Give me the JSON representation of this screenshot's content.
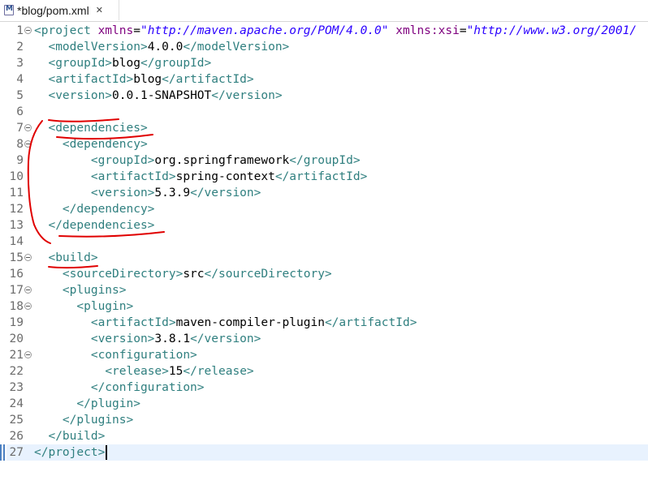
{
  "tab": {
    "title": "*blog/pom.xml",
    "close_glyph": "✕",
    "icon": "maven-pom-file-icon"
  },
  "editor": {
    "current_line": 27,
    "lines": [
      {
        "n": "1",
        "fold": true,
        "html": "<span class=\"t\">&lt;project</span> <span class=\"a\">xmlns</span>=<span class=\"s\">\"http://maven.apache.org/POM/4.0.0\"</span> <span class=\"a\">xmlns:xsi</span>=<span class=\"s\">\"http://www.w3.org/2001/</span>"
      },
      {
        "n": "2",
        "fold": false,
        "html": "  <span class=\"t\">&lt;modelVersion&gt;</span><span class=\"x\">4.0.0</span><span class=\"t\">&lt;/modelVersion&gt;</span>"
      },
      {
        "n": "3",
        "fold": false,
        "html": "  <span class=\"t\">&lt;groupId&gt;</span><span class=\"x\">blog</span><span class=\"t\">&lt;/groupId&gt;</span>"
      },
      {
        "n": "4",
        "fold": false,
        "html": "  <span class=\"t\">&lt;artifactId&gt;</span><span class=\"x\">blog</span><span class=\"t\">&lt;/artifactId&gt;</span>"
      },
      {
        "n": "5",
        "fold": false,
        "html": "  <span class=\"t\">&lt;version&gt;</span><span class=\"x\">0.0.1-SNAPSHOT</span><span class=\"t\">&lt;/version&gt;</span>"
      },
      {
        "n": "6",
        "fold": false,
        "html": ""
      },
      {
        "n": "7",
        "fold": true,
        "html": "  <span class=\"t\">&lt;dependencies&gt;</span>"
      },
      {
        "n": "8",
        "fold": true,
        "html": "    <span class=\"t\">&lt;dependency&gt;</span>"
      },
      {
        "n": "9",
        "fold": false,
        "html": "        <span class=\"t\">&lt;groupId&gt;</span><span class=\"x\">org.springframework</span><span class=\"t\">&lt;/groupId&gt;</span>"
      },
      {
        "n": "10",
        "fold": false,
        "html": "        <span class=\"t\">&lt;artifactId&gt;</span><span class=\"x\">spring-context</span><span class=\"t\">&lt;/artifactId&gt;</span>"
      },
      {
        "n": "11",
        "fold": false,
        "html": "        <span class=\"t\">&lt;version&gt;</span><span class=\"x\">5.3.9</span><span class=\"t\">&lt;/version&gt;</span>"
      },
      {
        "n": "12",
        "fold": false,
        "html": "    <span class=\"t\">&lt;/dependency&gt;</span>"
      },
      {
        "n": "13",
        "fold": false,
        "html": "  <span class=\"t\">&lt;/dependencies&gt;</span>"
      },
      {
        "n": "14",
        "fold": false,
        "html": ""
      },
      {
        "n": "15",
        "fold": true,
        "html": "  <span class=\"t\">&lt;build&gt;</span>"
      },
      {
        "n": "16",
        "fold": false,
        "html": "    <span class=\"t\">&lt;sourceDirectory&gt;</span><span class=\"x\">src</span><span class=\"t\">&lt;/sourceDirectory&gt;</span>"
      },
      {
        "n": "17",
        "fold": true,
        "html": "    <span class=\"t\">&lt;plugins&gt;</span>"
      },
      {
        "n": "18",
        "fold": true,
        "html": "      <span class=\"t\">&lt;plugin&gt;</span>"
      },
      {
        "n": "19",
        "fold": false,
        "html": "        <span class=\"t\">&lt;artifactId&gt;</span><span class=\"x\">maven-compiler-plugin</span><span class=\"t\">&lt;/artifactId&gt;</span>"
      },
      {
        "n": "20",
        "fold": false,
        "html": "        <span class=\"t\">&lt;version&gt;</span><span class=\"x\">3.8.1</span><span class=\"t\">&lt;/version&gt;</span>"
      },
      {
        "n": "21",
        "fold": true,
        "html": "        <span class=\"t\">&lt;configuration&gt;</span>"
      },
      {
        "n": "22",
        "fold": false,
        "html": "          <span class=\"t\">&lt;release&gt;</span><span class=\"x\">15</span><span class=\"t\">&lt;/release&gt;</span>"
      },
      {
        "n": "23",
        "fold": false,
        "html": "        <span class=\"t\">&lt;/configuration&gt;</span>"
      },
      {
        "n": "24",
        "fold": false,
        "html": "      <span class=\"t\">&lt;/plugin&gt;</span>"
      },
      {
        "n": "25",
        "fold": false,
        "html": "    <span class=\"t\">&lt;/plugins&gt;</span>"
      },
      {
        "n": "26",
        "fold": false,
        "html": "  <span class=\"t\">&lt;/build&gt;</span>"
      },
      {
        "n": "27",
        "fold": false,
        "html": "<span class=\"t\">&lt;/project&gt;</span>"
      }
    ]
  },
  "colors": {
    "tag": "#2f7f7f",
    "attribute": "#7f007f",
    "attribute_value": "#2a00ff",
    "annotation": "#e00000",
    "current_line": "#e8f2fe"
  }
}
